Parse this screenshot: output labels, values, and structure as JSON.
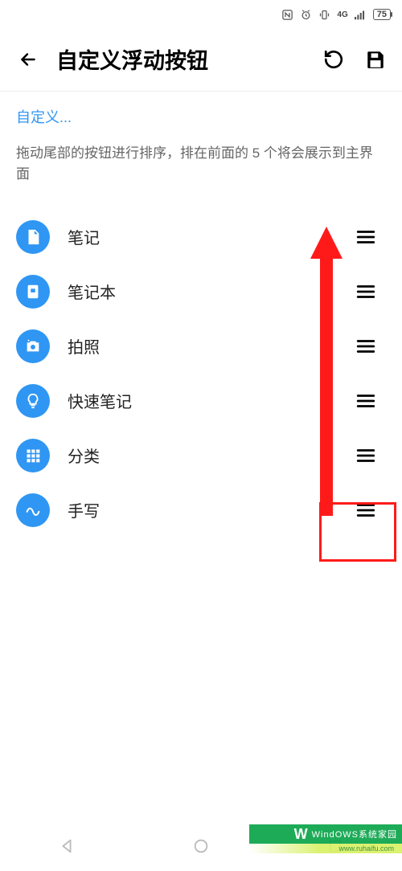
{
  "status": {
    "battery": "75"
  },
  "header": {
    "title": "自定义浮动按钮"
  },
  "content": {
    "link": "自定义...",
    "desc": "拖动尾部的按钮进行排序，排在前面的 5 个将会展示到主界面"
  },
  "items": [
    {
      "icon": "note-icon",
      "label": "笔记"
    },
    {
      "icon": "notebook-icon",
      "label": "笔记本"
    },
    {
      "icon": "camera-icon",
      "label": "拍照"
    },
    {
      "icon": "lightbulb-icon",
      "label": "快速笔记"
    },
    {
      "icon": "grid-icon",
      "label": "分类"
    },
    {
      "icon": "squiggle-icon",
      "label": "手写"
    }
  ],
  "watermark": {
    "line1": "WindOWS系统家园",
    "line2": "www.ruhaifu.com"
  }
}
